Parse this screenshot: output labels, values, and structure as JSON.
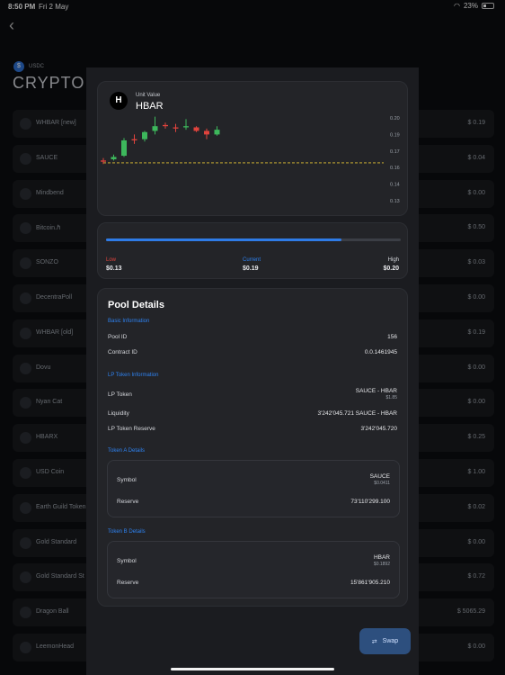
{
  "status": {
    "time": "8:50 PM",
    "date": "Fri 2 May",
    "battery": "23%"
  },
  "background": {
    "coin_label": "USDC",
    "title": "CRYPTO M",
    "rows": [
      {
        "name": "WHBAR [new]",
        "price": "$ 0.19"
      },
      {
        "name": "SAUCE",
        "price": "$ 0.04"
      },
      {
        "name": "Mindbend",
        "price": "$ 0.00"
      },
      {
        "name": "Bitcoin.ℏ",
        "price": "$ 0.50"
      },
      {
        "name": "SONZO",
        "price": "$ 0.03"
      },
      {
        "name": "DecentraPoll",
        "price": "$ 0.00"
      },
      {
        "name": "WHBAR [old]",
        "price": "$ 0.19"
      },
      {
        "name": "Dovu",
        "price": "$ 0.00"
      },
      {
        "name": "Nyan Cat",
        "price": "$ 0.00"
      },
      {
        "name": "HBARX",
        "price": "$ 0.25"
      },
      {
        "name": "USD Coin",
        "price": "$ 1.00"
      },
      {
        "name": "Earth Guild Token",
        "price": "$ 0.02"
      },
      {
        "name": "Gold Standard",
        "price": "$ 0.00"
      },
      {
        "name": "Gold Standard St",
        "price": "$ 0.72"
      },
      {
        "name": "Dragon Ball",
        "price": "$ 5065.29"
      },
      {
        "name": "LeemonHead",
        "price": "$ 0.00"
      }
    ]
  },
  "chart_card": {
    "logo_letter": "H",
    "unit_value_label": "Unit Value",
    "token_name": "HBAR"
  },
  "chart_data": {
    "type": "candlestick",
    "y_ticks": [
      "0.20",
      "0.19",
      "0.17",
      "0.16",
      "0.14",
      "0.13"
    ],
    "ylim": [
      0.13,
      0.2
    ],
    "reference_line": 0.162,
    "candles": [
      {
        "open": 0.163,
        "close": 0.164,
        "high": 0.166,
        "low": 0.161,
        "color": "red"
      },
      {
        "open": 0.165,
        "close": 0.167,
        "high": 0.169,
        "low": 0.164,
        "color": "green"
      },
      {
        "open": 0.168,
        "close": 0.181,
        "high": 0.183,
        "low": 0.167,
        "color": "green"
      },
      {
        "open": 0.181,
        "close": 0.182,
        "high": 0.186,
        "low": 0.178,
        "color": "red"
      },
      {
        "open": 0.182,
        "close": 0.188,
        "high": 0.189,
        "low": 0.18,
        "color": "green"
      },
      {
        "open": 0.189,
        "close": 0.193,
        "high": 0.201,
        "low": 0.186,
        "color": "green"
      },
      {
        "open": 0.193,
        "close": 0.194,
        "high": 0.196,
        "low": 0.191,
        "color": "red"
      },
      {
        "open": 0.192,
        "close": 0.191,
        "high": 0.195,
        "low": 0.188,
        "color": "red"
      },
      {
        "open": 0.192,
        "close": 0.193,
        "high": 0.199,
        "low": 0.19,
        "color": "green"
      },
      {
        "open": 0.192,
        "close": 0.189,
        "high": 0.193,
        "low": 0.188,
        "color": "red"
      },
      {
        "open": 0.189,
        "close": 0.186,
        "high": 0.191,
        "low": 0.182,
        "color": "red"
      },
      {
        "open": 0.186,
        "close": 0.19,
        "high": 0.193,
        "low": 0.185,
        "color": "green"
      }
    ],
    "colors": {
      "up": "#3db85c",
      "down": "#e0433d",
      "ref": "#e3c234"
    }
  },
  "range": {
    "low_label": "Low",
    "low_value": "$0.13",
    "current_label": "Current",
    "current_value": "$0.19",
    "high_label": "High",
    "high_value": "$0.20",
    "fill_fraction": 0.8
  },
  "pool": {
    "title": "Pool Details",
    "basic_header": "Basic Information",
    "pool_id_label": "Pool ID",
    "pool_id": "156",
    "contract_label": "Contract ID",
    "contract_id": "0.0.1461945",
    "lp_header": "LP Token Information",
    "lp_token_label": "LP Token",
    "lp_token": "SAUCE - HBAR",
    "lp_token_price": "$1.85",
    "liquidity_label": "Liquidity",
    "liquidity": "3'242'045.721 SAUCE - HBAR",
    "lp_reserve_label": "LP Token Reserve",
    "lp_reserve": "3'242'045.720",
    "token_a_header": "Token A Details",
    "a_symbol_label": "Symbol",
    "a_symbol": "SAUCE",
    "a_price": "$0.0411",
    "a_reserve_label": "Reserve",
    "a_reserve": "73'110'299.100",
    "token_b_header": "Token B Details",
    "b_symbol_label": "Symbol",
    "b_symbol": "HBAR",
    "b_price": "$0.1892",
    "b_reserve_label": "Reserve",
    "b_reserve": "15'861'905.210"
  },
  "swap_label": "Swap",
  "colors": {
    "accent": "#2e7be6",
    "low": "#e0433d",
    "current": "#2e82f0"
  }
}
